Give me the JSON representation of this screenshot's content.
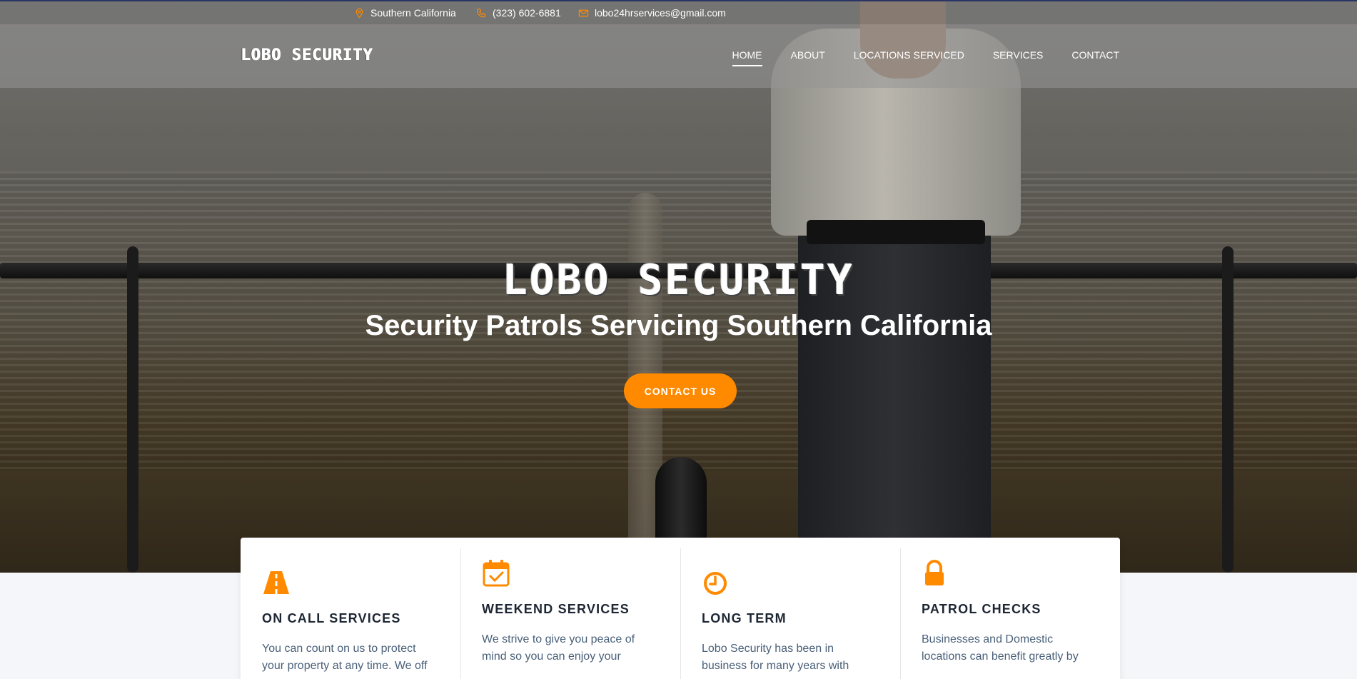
{
  "topbar": {
    "location": "Southern California",
    "phone": "(323) 602-6881",
    "email": "lobo24hrservices@gmail.com"
  },
  "navbar": {
    "logo": "LOBO SECURITY",
    "links": [
      {
        "label": "HOME",
        "active": true
      },
      {
        "label": "ABOUT"
      },
      {
        "label": "LOCATIONS SERVICED"
      },
      {
        "label": "SERVICES"
      },
      {
        "label": "CONTACT"
      }
    ]
  },
  "hero": {
    "title": "LOBO SECURITY",
    "subtitle": "Security Patrols Servicing Southern California",
    "button": "CONTACT US"
  },
  "features": [
    {
      "icon": "road-icon",
      "title": "ON CALL SERVICES",
      "text": "You can count on us to protect your property at any time. We off"
    },
    {
      "icon": "calendar-check-icon",
      "title": "WEEKEND SERVICES",
      "text": "We strive to give you peace of mind so you can enjoy your"
    },
    {
      "icon": "clock-icon",
      "title": "LONG TERM",
      "text": "Lobo Security has been in business for many years with"
    },
    {
      "icon": "lock-icon",
      "title": "PATROL CHECKS",
      "text": "Businesses and Domestic locations can benefit greatly by"
    }
  ],
  "colors": {
    "accent": "#ff8a00",
    "heading": "#1d2633",
    "body_text": "#4a6079",
    "topbar_border": "#2a3566"
  }
}
